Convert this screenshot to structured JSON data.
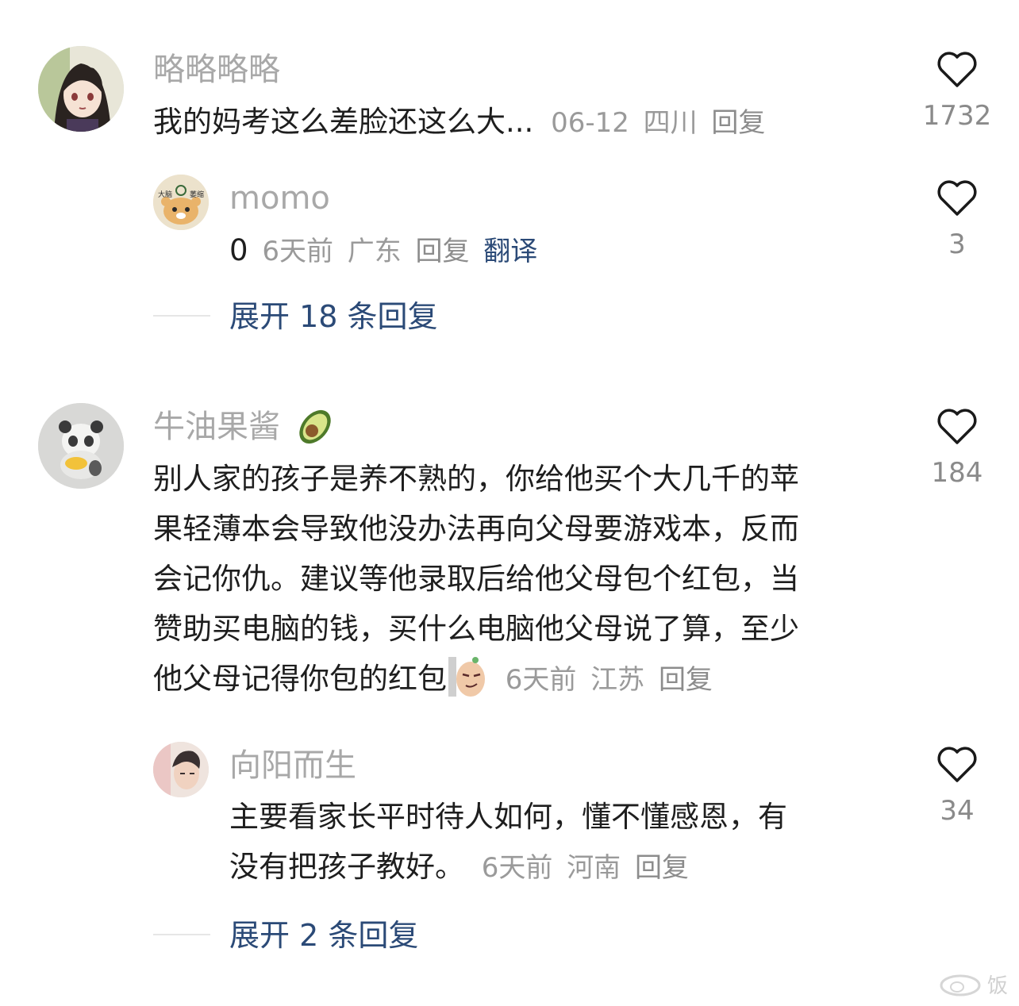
{
  "comments": [
    {
      "username": "略略略略",
      "text": "我的妈考这么差脸还这么大...",
      "date": "06-12",
      "location": "四川",
      "reply": "回复",
      "likes": "1732",
      "avatar": "anime-girl-avatar",
      "replies": [
        {
          "username": "momo",
          "text": "0",
          "date": "6天前",
          "location": "广东",
          "reply": "回复",
          "translate": "翻译",
          "likes": "3",
          "avatar": "cartoon-bear-avatar",
          "avatar_labels": [
            "大脑",
            "萎缩"
          ]
        }
      ],
      "expand": "展开 18 条回复"
    },
    {
      "username": "牛油果酱",
      "username_emoji": "avocado-icon",
      "text_lines": [
        "别人家的孩子是养不熟的，你给他买个大几千的苹",
        "果轻薄本会导致他没办法再向父母要游戏本，反而",
        "会记你仇。建议等他录取后给他父母包个红包，当",
        "赞助买电脑的钱，买什么电脑他父母说了算，至少",
        "他父母记得你包的红包"
      ],
      "trailing_emoji": "smirk-peanut-icon",
      "date": "6天前",
      "location": "江苏",
      "reply": "回复",
      "likes": "184",
      "avatar": "panda-figure-avatar",
      "replies": [
        {
          "username": "向阳而生",
          "text_lines": [
            "主要看家长平时待人如何，懂不懂感恩，有",
            "没有把孩子教好。"
          ],
          "date": "6天前",
          "location": "河南",
          "reply": "回复",
          "likes": "34",
          "avatar": "man-portrait-avatar"
        }
      ],
      "expand": "展开 2 条回复"
    }
  ],
  "watermark": "饭",
  "colors": {
    "username": "#a8a8a8",
    "meta": "#9a9a9a",
    "link_blue": "#2b4a77",
    "body_text": "#1e1e1e"
  }
}
